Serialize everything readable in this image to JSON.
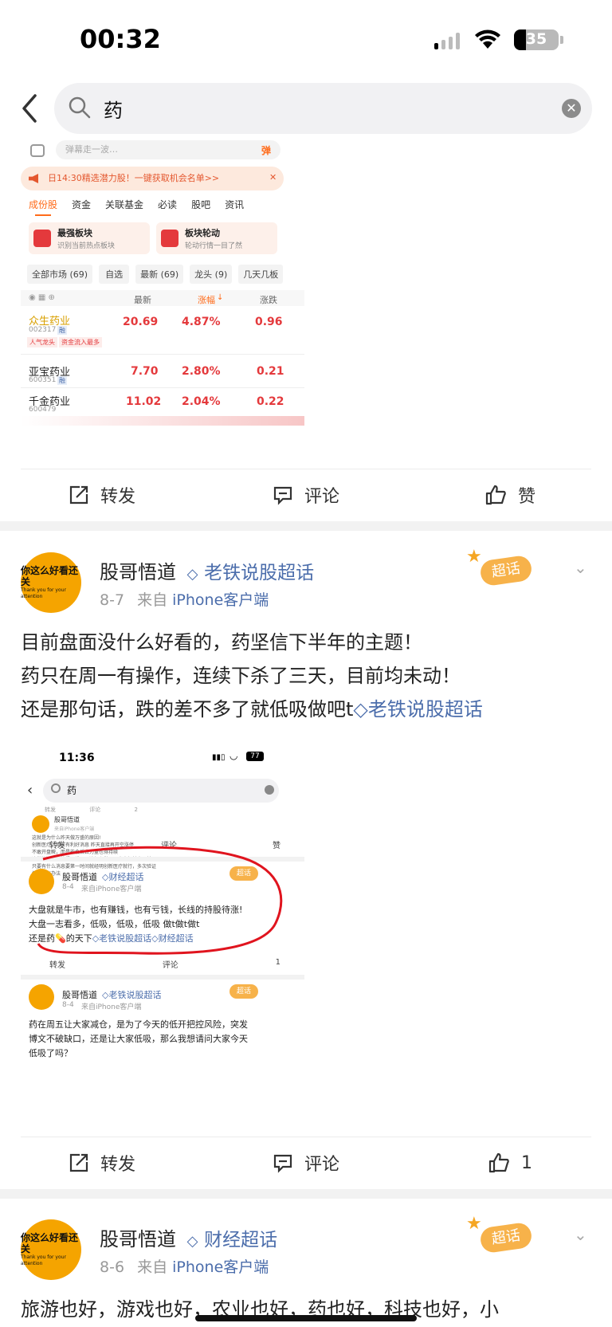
{
  "status": {
    "time": "00:32",
    "battery": "35"
  },
  "search": {
    "query": "药"
  },
  "shot1": {
    "danmu_placeholder": "弹幕走一波…",
    "danmu_icon": "弹",
    "banner": "日14:30精选潜力股！一键获取机会名单>>",
    "tabs": [
      "成份股",
      "资金",
      "关联基金",
      "必读",
      "股吧",
      "资讯"
    ],
    "cards": [
      {
        "title": "最强板块",
        "sub": "识别当前热点板块"
      },
      {
        "title": "板块轮动",
        "sub": "轮动行情一目了然"
      }
    ],
    "filters": [
      "全部市场 (69)",
      "自选",
      "最新 (69)",
      "龙头 (9)",
      "几天几板"
    ],
    "columns": [
      "最新",
      "涨幅",
      "涨跌"
    ],
    "stocks": [
      {
        "name": "众生药业",
        "code": "002317",
        "mkt": "融",
        "price": "20.69",
        "pct": "4.87%",
        "chg": "0.96",
        "tags": [
          "人气龙头",
          "资金流入最多"
        ]
      },
      {
        "name": "亚宝药业",
        "code": "600351",
        "mkt": "融",
        "price": "7.70",
        "pct": "2.80%",
        "chg": "0.21"
      },
      {
        "name": "千金药业",
        "code": "600479",
        "mkt": "",
        "price": "11.02",
        "pct": "2.04%",
        "chg": "0.22"
      }
    ]
  },
  "actions1": {
    "repost": "转发",
    "comment": "评论",
    "like": "赞"
  },
  "post1": {
    "user": "股哥悟道",
    "topic": "老铁说股超话",
    "badge": "超话",
    "date": "8-7",
    "from": "来自",
    "client": "iPhone客户端",
    "lines": [
      "目前盘面没什么好看的，药坚信下半年的主题！",
      "药只在周一有操作，连续下杀了三天，目前均未动！",
      "还是那句话，跌的差不多了就低吸做吧t"
    ],
    "inline_topic": "老铁说股超话"
  },
  "avatar": {
    "text": "你这么好看还关",
    "sub": "Thank you for your attention"
  },
  "shot2": {
    "time": "11:36",
    "battery": "77",
    "query": "药",
    "mini_tabs": [
      "转发",
      "评论",
      "2"
    ],
    "mini_name": "股哥悟道",
    "mini_meta": "来自iPhone客户端",
    "mini_lines": [
      "这就是为什么昨天做万盛的原因!",
      "创新医疗，周末有利好消息 昨天直接再开空涨停",
      "不敢开盘瞬，而是能会后去力量也得持续",
      "这样的话就会拉得不错，无论怎么做，马来克好基本以前",
      "只要有什么消息要第一时间就经明创新医疗就行，多次验证",
      "仍然没有办法"
    ],
    "actions": [
      "转发",
      "评论",
      "赞"
    ],
    "p1": {
      "user": "股哥悟道",
      "topic": "财经超话",
      "date": "8-4",
      "meta": "来自iPhone客户端",
      "lines": [
        "大盘就是牛市，也有赚钱，也有亏钱，长线的持股待涨!",
        "大盘一志看多，低吸，低吸，低吸 做t做t做t",
        "还是药💊的天下"
      ],
      "t1": "老铁说股超话",
      "t2": "财经超话"
    },
    "p1_actions": [
      "转发",
      "评论",
      "1"
    ],
    "p2": {
      "user": "股哥悟道",
      "topic": "老铁说股超话",
      "date": "8-4",
      "meta": "来自iPhone客户端",
      "lines": [
        "药在周五让大家减仓，是为了今天的低开把控风险，突发",
        "博文不破缺口，还是让大家低吸，那么我想请问大家今天",
        "低吸了吗？"
      ]
    }
  },
  "actions2": {
    "repost": "转发",
    "comment": "评论",
    "like": "1"
  },
  "post2": {
    "user": "股哥悟道",
    "topic": "财经超话",
    "badge": "超话",
    "date": "8-6",
    "from": "来自",
    "client": "iPhone客户端",
    "line": "旅游也好，游戏也好，农业也好，药也好，科技也好，小"
  },
  "colors": {
    "link": "#4b6dab",
    "red": "#e4393c",
    "orange": "#ff6b1a"
  }
}
